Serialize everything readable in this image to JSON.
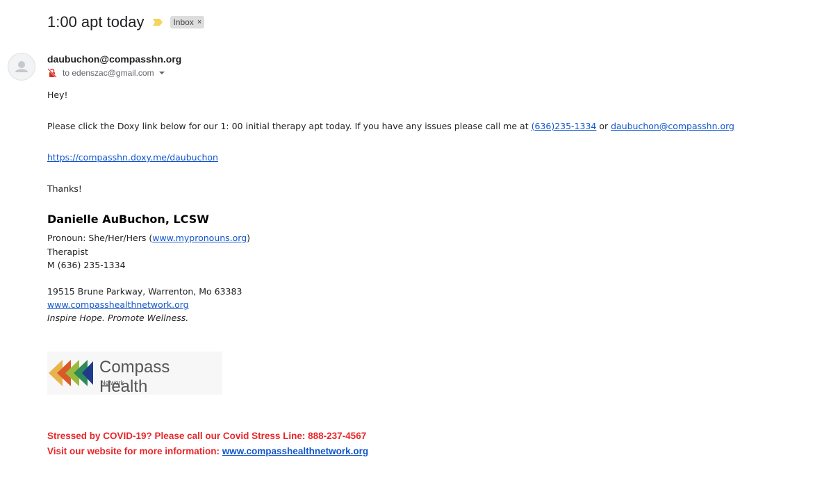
{
  "email": {
    "subject": "1:00 apt today",
    "label": "Inbox",
    "label_remove": "×",
    "sender": "daubuchon@compasshn.org",
    "to_line": "to edenszac@gmail.com"
  },
  "body": {
    "greeting": "Hey!",
    "para_text": "Please click the Doxy link below for our 1: 00 initial therapy apt today. If you have any issues please call me at ",
    "phone_link": "(636)235-1334",
    "or_text": " or ",
    "email_link": "daubuchon@compasshn.org",
    "doxy_link": "https://compasshn.doxy.me/daubuchon",
    "thanks": "Thanks!"
  },
  "signature": {
    "name": "Danielle AuBuchon, LCSW",
    "pronoun_prefix": "Pronoun: She/Her/Hers (",
    "pronoun_link": "www.mypronouns.org",
    "pronoun_suffix": ")",
    "title": "Therapist",
    "mobile": "M (636) 235-1334",
    "address": "19515 Brune Parkway, Warrenton, Mo 63383",
    "website": "www.compasshealthnetwork.org",
    "tagline": "Inspire Hope. Promote Wellness.",
    "logo_name": "Compass Health",
    "logo_sub": "Network"
  },
  "covid": {
    "line1": "Stressed by COVID-19?  Please call our Covid Stress Line: 888-237-4567",
    "line2_prefix": "Visit our website for more information: ",
    "line2_link": "www.compasshealthnetwork.org"
  },
  "colors": {
    "link": "#1155cc",
    "covid_red": "#e8262a",
    "importance_yellow": "#f4d45b"
  },
  "icons": [
    "importance-marker-icon",
    "person-icon",
    "not-encrypted-icon",
    "chevron-down-icon"
  ]
}
